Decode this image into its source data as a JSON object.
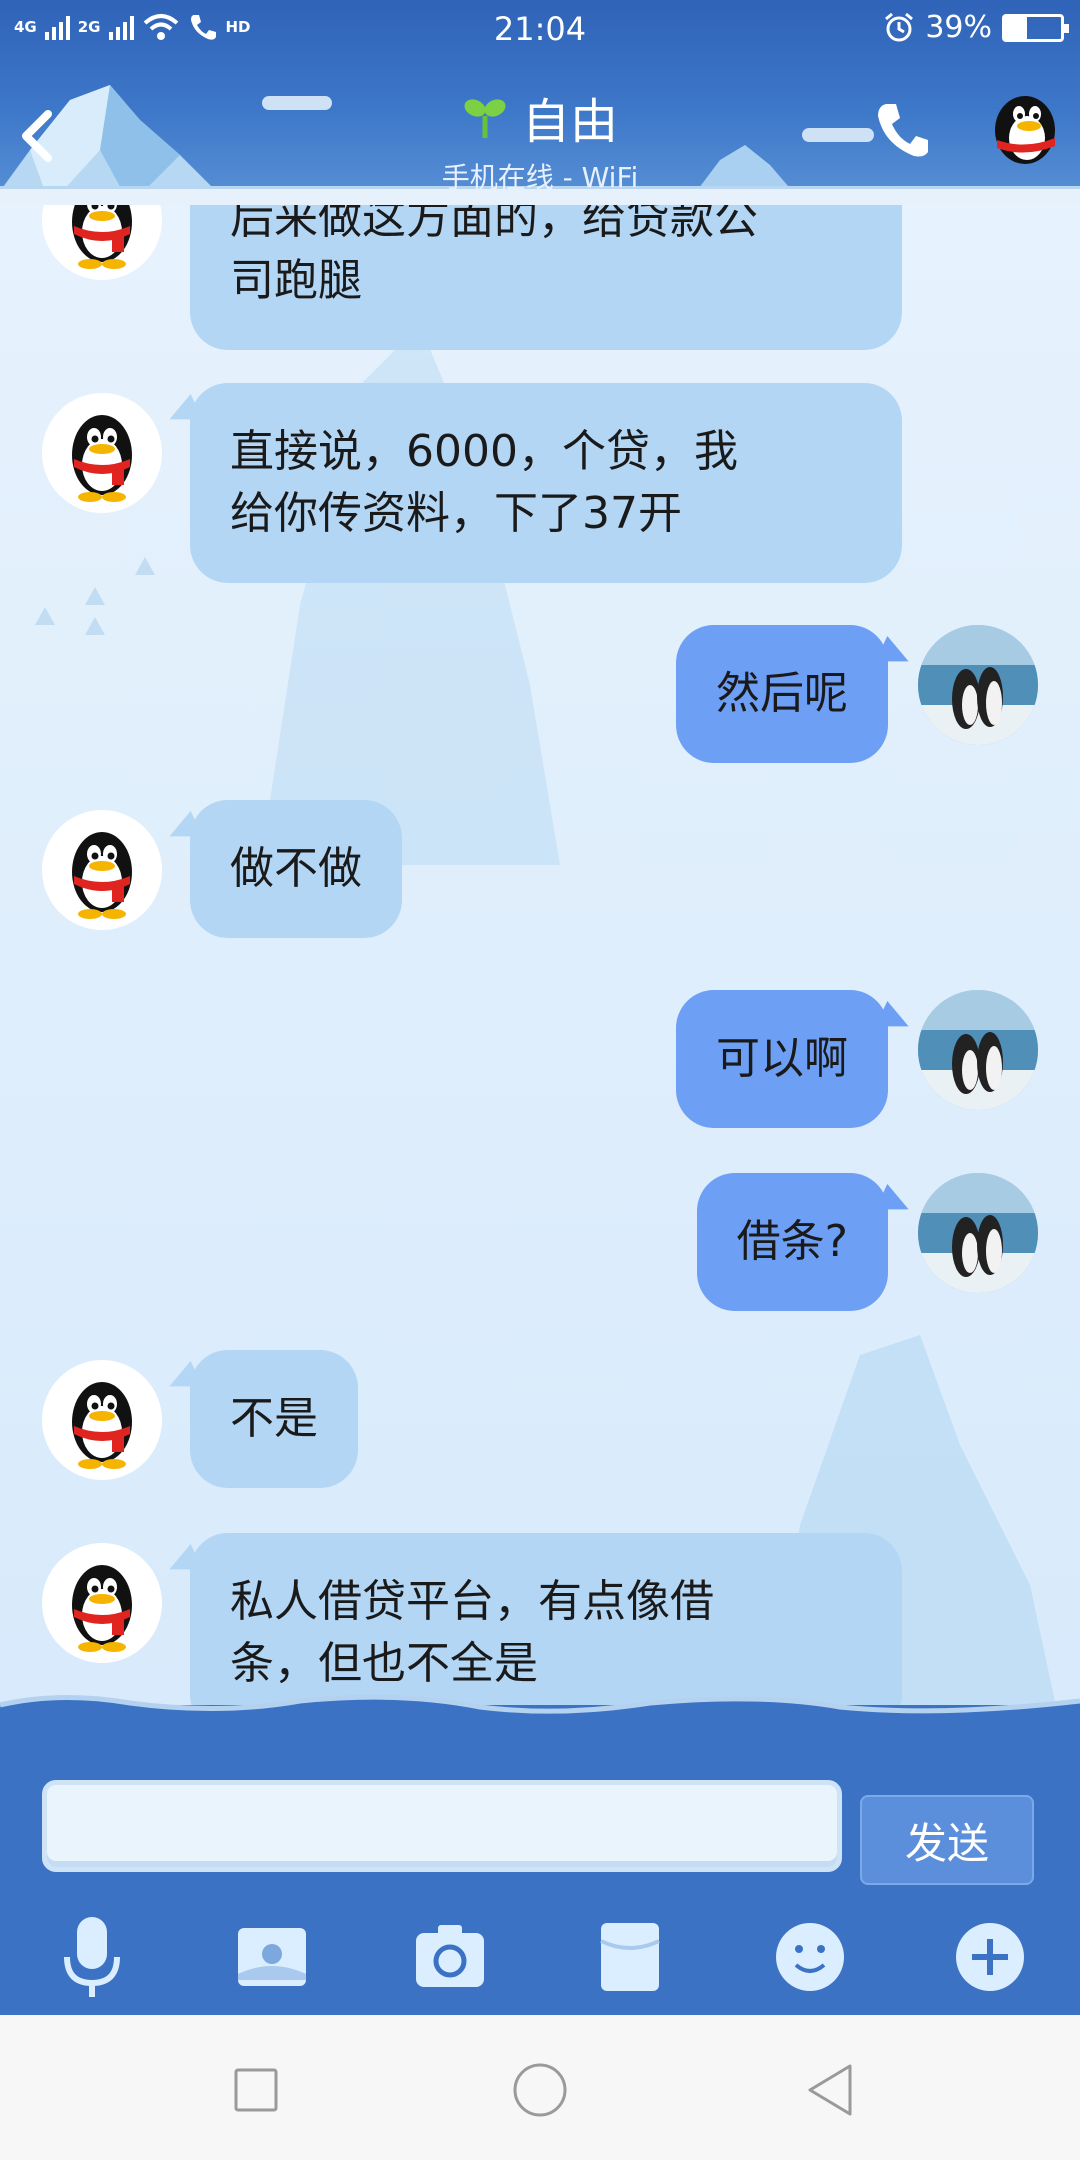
{
  "status_bar": {
    "network_1": "4G",
    "network_2": "2G",
    "call_label": "HD",
    "time": "21:04",
    "battery_percent": "39%",
    "battery_level": 0.39
  },
  "header": {
    "title": "自由",
    "subtitle": "手机在线 - WiFi"
  },
  "messages": [
    {
      "side": "in",
      "text_lines": [
        "后来做这方面的，给贷款公",
        "司跑腿"
      ]
    },
    {
      "side": "in",
      "text_lines": [
        "直接说，6000，个贷，我",
        "给你传资料，下了37开"
      ]
    },
    {
      "side": "out",
      "text_lines": [
        "然后呢"
      ]
    },
    {
      "side": "in",
      "text_lines": [
        "做不做"
      ]
    },
    {
      "side": "out",
      "text_lines": [
        "可以啊"
      ]
    },
    {
      "side": "out",
      "text_lines": [
        "借条?"
      ]
    },
    {
      "side": "in",
      "text_lines": [
        "不是"
      ]
    },
    {
      "side": "in",
      "text_lines": [
        "私人借贷平台，有点像借",
        "条，但也不全是"
      ]
    }
  ],
  "input": {
    "placeholder": "",
    "send_label": "发送"
  },
  "toolbar": {
    "items": [
      "microphone-icon",
      "image-icon",
      "camera-icon",
      "red-packet-icon",
      "emoji-icon",
      "plus-icon"
    ]
  },
  "navigation": {
    "items": [
      "recent-apps-icon",
      "home-icon",
      "back-icon"
    ]
  },
  "colors": {
    "header_blue": "#3e78c9",
    "incoming_bubble": "#b3d6f5",
    "outgoing_bubble": "#6d9ff5",
    "input_bar": "#3b72c4"
  }
}
